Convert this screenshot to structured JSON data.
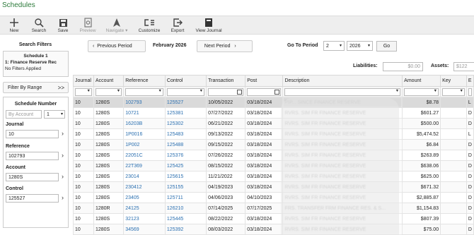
{
  "app": {
    "title": "Schedules"
  },
  "toolbar": {
    "new": "New",
    "search": "Search",
    "save": "Save",
    "preview": "Preview",
    "navigate": "Navigate",
    "customize": "Customize",
    "export": "Export",
    "view_journal": "View Journal"
  },
  "left": {
    "search_filters": "Search Filters",
    "schedule_title": "Schedule 1",
    "schedule_name": "1: Finance Reserve Rec",
    "no_filters": "No Filters Applied",
    "filter_by_range": "Filter By Range",
    "filter_arrow": ">>",
    "schedule_number": "Schedule Number",
    "by_account_placeholder": "By Account",
    "by_account_value": "1",
    "journal_label": "Journal",
    "journal_value": "10",
    "reference_label": "Reference",
    "reference_value": "102793",
    "account_label": "Account",
    "account_value": "1280S",
    "control_label": "Control",
    "control_value": "125527"
  },
  "period_nav": {
    "prev": "Previous Period",
    "current": "February 2026",
    "next": "Next Period",
    "go_to_period": "Go To Period",
    "period_select": "2",
    "year_select": "2026",
    "go": "Go"
  },
  "totals": {
    "liabilities_label": "Liabilities:",
    "liabilities_value": "$0.00",
    "assets_label": "Assets:",
    "assets_value": "$122"
  },
  "table": {
    "columns": [
      "Journal",
      "Account",
      "Reference",
      "Control",
      "Transaction",
      "Post",
      "Description",
      "Amount",
      "Key",
      "E"
    ],
    "rows": [
      {
        "journal": "10",
        "account": "1280S",
        "reference": "102793",
        "control": "125527",
        "transaction": "10/05/2022",
        "post": "03/18/2024",
        "description": "PIP... SINCE FINANCE RESERVE",
        "amount": "$8.78",
        "key": "",
        "e": "L"
      },
      {
        "journal": "10",
        "account": "1280S",
        "reference": "10721",
        "control": "125381",
        "transaction": "07/27/2022",
        "post": "03/18/2024",
        "description": "RVRS. SIM FR FINANCE RESERVE",
        "amount": "$601.27",
        "key": "",
        "e": "D"
      },
      {
        "journal": "10",
        "account": "1280S",
        "reference": "16203B",
        "control": "125302",
        "transaction": "06/21/2022",
        "post": "03/18/2024",
        "description": "RVRS. SIM FR FINANCE RESERVE",
        "amount": "$500.00",
        "key": "",
        "e": "D"
      },
      {
        "journal": "10",
        "account": "1280S",
        "reference": "1P0016",
        "control": "125483",
        "transaction": "09/13/2022",
        "post": "03/18/2024",
        "description": "RVRS. SIM FR FINANCE RESERVE",
        "amount": "$5,474.52",
        "key": "",
        "e": "L"
      },
      {
        "journal": "10",
        "account": "1280S",
        "reference": "1P002",
        "control": "125488",
        "transaction": "09/15/2022",
        "post": "03/18/2024",
        "description": "RVRS. SIM FR FINANCE RESERVE",
        "amount": "$6.84",
        "key": "",
        "e": "D"
      },
      {
        "journal": "10",
        "account": "1280S",
        "reference": "22051C",
        "control": "125376",
        "transaction": "07/26/2022",
        "post": "03/18/2024",
        "description": "RVRS. SIM FR FINANCE RESERVE",
        "amount": "$263.89",
        "key": "",
        "e": "D"
      },
      {
        "journal": "10",
        "account": "1280S",
        "reference": "22T369",
        "control": "125425",
        "transaction": "08/15/2022",
        "post": "03/18/2024",
        "description": "RVRS. SIM FR FINANCE RESERVE",
        "amount": "$638.06",
        "key": "",
        "e": "D"
      },
      {
        "journal": "10",
        "account": "1280S",
        "reference": "23014",
        "control": "125615",
        "transaction": "11/21/2022",
        "post": "03/18/2024",
        "description": "RVRS. SIM FR FINANCE RESERVE",
        "amount": "$625.00",
        "key": "",
        "e": "D"
      },
      {
        "journal": "10",
        "account": "1280S",
        "reference": "230412",
        "control": "125155",
        "transaction": "04/19/2023",
        "post": "03/18/2024",
        "description": "RVRS. SIM FR FINANCE RESERVE",
        "amount": "$671.32",
        "key": "",
        "e": "D"
      },
      {
        "journal": "10",
        "account": "1280S",
        "reference": "23405",
        "control": "125711",
        "transaction": "04/06/2023",
        "post": "04/10/2023",
        "description": "RVRS. SIM FR FINANCE RESERVE",
        "amount": "$2,885.87",
        "key": "",
        "e": "D"
      },
      {
        "journal": "10",
        "account": "1280R",
        "reference": "24125",
        "control": "126210",
        "transaction": "07/14/2025",
        "post": "07/17/2025",
        "description": "FRS. TRANSFER FRM FINANCE RES. & S...",
        "amount": "$1,154.83",
        "key": "",
        "e": "D"
      },
      {
        "journal": "10",
        "account": "1280S",
        "reference": "32123",
        "control": "125445",
        "transaction": "08/22/2022",
        "post": "03/18/2024",
        "description": "RVRS. SIM FR FINANCE RESERVE",
        "amount": "$807.39",
        "key": "",
        "e": "D"
      },
      {
        "journal": "10",
        "account": "1280S",
        "reference": "34569",
        "control": "125392",
        "transaction": "08/03/2022",
        "post": "03/18/2024",
        "description": "RVRS. SIM FR FINANCE RESERVE",
        "amount": "$75.00",
        "key": "",
        "e": "D"
      }
    ]
  }
}
